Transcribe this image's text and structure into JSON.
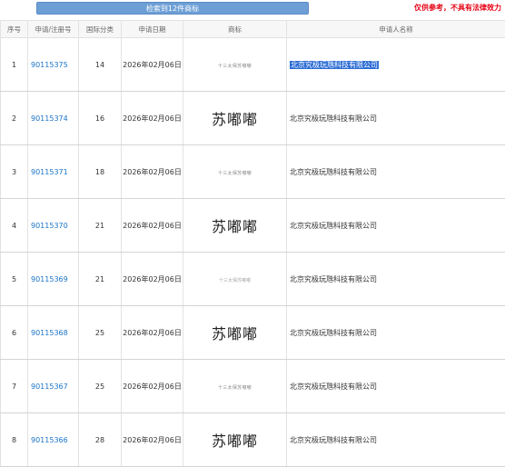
{
  "header": {
    "result_button": "检索到12件商标",
    "disclaimer": "仅供参考，不具有法律效力"
  },
  "table": {
    "columns": [
      "序号",
      "申请/注册号",
      "国际分类",
      "申请日期",
      "商标",
      "申请人名称"
    ],
    "rows": [
      {
        "no": "1",
        "reg": "90115375",
        "cls": "14",
        "date": "2026年02月06日",
        "mark_type": "small",
        "mark_text": "十三太保苏嘟嘟",
        "holder": "北京究极玩虺科技有限公司",
        "selected": true
      },
      {
        "no": "2",
        "reg": "90115374",
        "cls": "16",
        "date": "2026年02月06日",
        "mark_type": "big",
        "mark_text": "苏嘟嘟",
        "holder": "北京究极玩虺科技有限公司",
        "selected": false
      },
      {
        "no": "3",
        "reg": "90115371",
        "cls": "18",
        "date": "2026年02月06日",
        "mark_type": "small",
        "mark_text": "十三太保苏嘟嘟",
        "holder": "北京究极玩虺科技有限公司",
        "selected": false
      },
      {
        "no": "4",
        "reg": "90115370",
        "cls": "21",
        "date": "2026年02月06日",
        "mark_type": "big",
        "mark_text": "苏嘟嘟",
        "holder": "北京究极玩虺科技有限公司",
        "selected": false
      },
      {
        "no": "5",
        "reg": "90115369",
        "cls": "21",
        "date": "2026年02月06日",
        "mark_type": "faint",
        "mark_text": "十三太保苏嘟嘟",
        "holder": "北京究极玩虺科技有限公司",
        "selected": false
      },
      {
        "no": "6",
        "reg": "90115368",
        "cls": "25",
        "date": "2026年02月06日",
        "mark_type": "big",
        "mark_text": "苏嘟嘟",
        "holder": "北京究极玩虺科技有限公司",
        "selected": false
      },
      {
        "no": "7",
        "reg": "90115367",
        "cls": "25",
        "date": "2026年02月06日",
        "mark_type": "small",
        "mark_text": "十三太保苏嘟嘟",
        "holder": "北京究极玩虺科技有限公司",
        "selected": false
      },
      {
        "no": "8",
        "reg": "90115366",
        "cls": "28",
        "date": "2026年02月06日",
        "mark_type": "big",
        "mark_text": "苏嘟嘟",
        "holder": "北京究极玩虺科技有限公司",
        "selected": false
      }
    ]
  }
}
